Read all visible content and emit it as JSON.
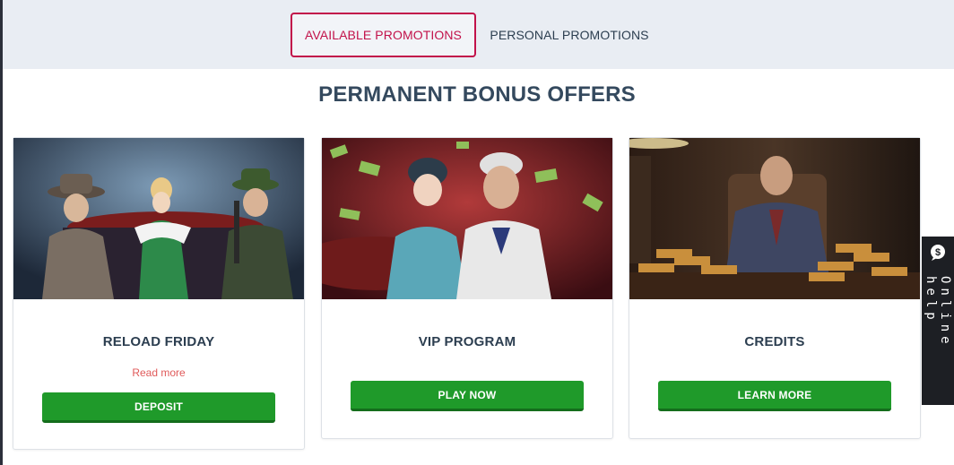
{
  "tabs": [
    {
      "label": "AVAILABLE PROMOTIONS",
      "active": true
    },
    {
      "label": "PERSONAL PROMOTIONS",
      "active": false
    }
  ],
  "page_title": "PERMANENT BONUS OFFERS",
  "cards": [
    {
      "title": "RELOAD FRIDAY",
      "read_more": "Read more",
      "button": "DEPOSIT",
      "image": "gangsters-casino-illustration"
    },
    {
      "title": "VIP PROGRAM",
      "read_more": "",
      "button": "PLAY NOW",
      "image": "flapper-and-gentleman-illustration"
    },
    {
      "title": "CREDITS",
      "read_more": "",
      "button": "LEARN MORE",
      "image": "mob-boss-with-money-illustration"
    }
  ],
  "help": {
    "label": "Online help",
    "icon": "chat-dollar-icon"
  },
  "colors": {
    "accent": "#c2124a",
    "button": "#1f9a2a",
    "title": "#34495e",
    "tabs_bg": "#e9edf3",
    "read_more": "#e05a5a"
  }
}
